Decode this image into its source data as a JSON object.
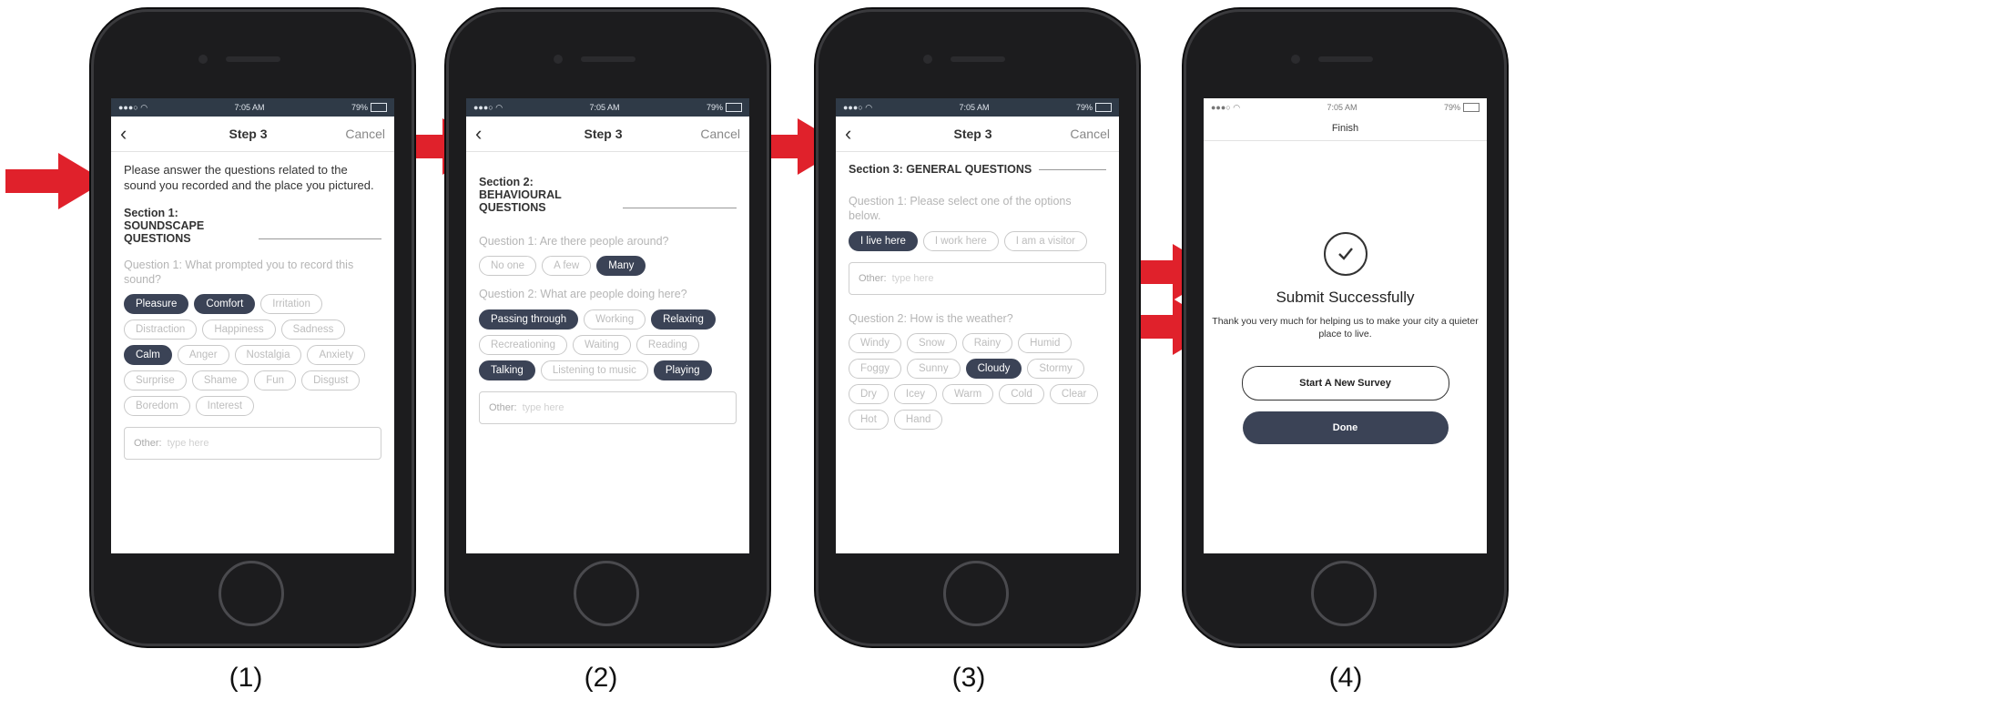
{
  "colors": {
    "arrow": "#e0212b",
    "chip_selected": "#3b4356",
    "status_bar": "#2f3a47"
  },
  "status": {
    "time": "7:05 AM",
    "battery": "79%"
  },
  "captions": [
    "(1)",
    "(2)",
    "(3)",
    "(4)"
  ],
  "screen1": {
    "nav": {
      "back": "‹",
      "title": "Step 3",
      "cancel": "Cancel"
    },
    "intro": "Please answer the questions related to the sound you recorded and the place you pictured.",
    "section": "Section 1: SOUNDSCAPE QUESTIONS",
    "question1": "Question 1: What prompted you to record this sound?",
    "chips": [
      {
        "label": "Pleasure",
        "selected": true
      },
      {
        "label": "Comfort",
        "selected": true
      },
      {
        "label": "Irritation",
        "selected": false
      },
      {
        "label": "Distraction",
        "selected": false
      },
      {
        "label": "Happiness",
        "selected": false
      },
      {
        "label": "Sadness",
        "selected": false
      },
      {
        "label": "Calm",
        "selected": true
      },
      {
        "label": "Anger",
        "selected": false
      },
      {
        "label": "Nostalgia",
        "selected": false
      },
      {
        "label": "Anxiety",
        "selected": false
      },
      {
        "label": "Surprise",
        "selected": false
      },
      {
        "label": "Shame",
        "selected": false
      },
      {
        "label": "Fun",
        "selected": false
      },
      {
        "label": "Disgust",
        "selected": false
      },
      {
        "label": "Boredom",
        "selected": false
      },
      {
        "label": "Interest",
        "selected": false
      }
    ],
    "other_label": "Other:",
    "other_placeholder": "type here"
  },
  "screen2": {
    "nav": {
      "back": "‹",
      "title": "Step 3",
      "cancel": "Cancel"
    },
    "section": "Section 2: BEHAVIOURAL QUESTIONS",
    "question1": "Question 1: Are there people around?",
    "chips1": [
      {
        "label": "No one",
        "selected": false
      },
      {
        "label": "A few",
        "selected": false
      },
      {
        "label": "Many",
        "selected": true
      }
    ],
    "question2": "Question 2: What are people doing here?",
    "chips2": [
      {
        "label": "Passing through",
        "selected": true
      },
      {
        "label": "Working",
        "selected": false
      },
      {
        "label": "Relaxing",
        "selected": true
      },
      {
        "label": "Recreationing",
        "selected": false
      },
      {
        "label": "Waiting",
        "selected": false
      },
      {
        "label": "Reading",
        "selected": false
      },
      {
        "label": "Talking",
        "selected": true
      },
      {
        "label": "Listening to music",
        "selected": false
      },
      {
        "label": "Playing",
        "selected": true
      }
    ],
    "other_label": "Other:",
    "other_placeholder": "type here"
  },
  "screen3": {
    "nav": {
      "back": "‹",
      "title": "Step 3",
      "cancel": "Cancel"
    },
    "section": "Section 3: GENERAL QUESTIONS",
    "question1": "Question 1: Please select one of the options below.",
    "chips1": [
      {
        "label": "I live here",
        "selected": true
      },
      {
        "label": "I work here",
        "selected": false
      },
      {
        "label": "I am a visitor",
        "selected": false
      }
    ],
    "other_label": "Other:",
    "other_placeholder": "type here",
    "question2": "Question 2: How is the weather?",
    "chips2": [
      {
        "label": "Windy",
        "selected": false
      },
      {
        "label": "Snow",
        "selected": false
      },
      {
        "label": "Rainy",
        "selected": false
      },
      {
        "label": "Humid",
        "selected": false
      },
      {
        "label": "Foggy",
        "selected": false
      },
      {
        "label": "Sunny",
        "selected": false
      },
      {
        "label": "Cloudy",
        "selected": true
      },
      {
        "label": "Stormy",
        "selected": false
      },
      {
        "label": "Dry",
        "selected": false
      },
      {
        "label": "Icey",
        "selected": false
      },
      {
        "label": "Warm",
        "selected": false
      },
      {
        "label": "Cold",
        "selected": false
      },
      {
        "label": "Clear",
        "selected": false
      },
      {
        "label": "Hot",
        "selected": false
      },
      {
        "label": "Hand",
        "selected": false
      }
    ]
  },
  "screen4": {
    "nav_title": "Finish",
    "success_title": "Submit Successfully",
    "thanks": "Thank you very much for helping us to make your city a quieter place to live.",
    "start_button": "Start A New Survey",
    "done_button": "Done"
  }
}
